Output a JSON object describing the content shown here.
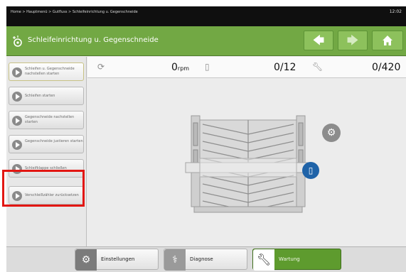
{
  "breadcrumb": {
    "text": "Home > Hauptmenü > Gutfluss > Schleifeinrichtung u. Gegenschneide"
  },
  "clock": {
    "time": "12:02"
  },
  "header": {
    "title": "Schleifeinrichtung u. Gegenschneide",
    "back_icon": "arrow-left-icon",
    "forward_icon": "arrow-right-icon",
    "home_icon": "home-icon"
  },
  "sidebar": {
    "items": [
      {
        "label": "Schleifen u. Gegenschneide nachstellen starten"
      },
      {
        "label": "Schleifen starten"
      },
      {
        "label": "Gegenschneide nachstellen starten"
      },
      {
        "label": "Gegenschneide justieren starten"
      },
      {
        "label": "Schleifklappe schließen"
      },
      {
        "label": "Verschleißzähler zurücksetzen"
      }
    ]
  },
  "status": {
    "rpm_value": "0",
    "rpm_unit": "rpm",
    "count": "0/12",
    "tool_count": "0/420"
  },
  "bottom": {
    "settings_label": "Einstellungen",
    "diagnose_label": "Diagnose",
    "maintenance_label": "Wartung"
  },
  "colors": {
    "header_green": "#72a844",
    "maintenance_green": "#5e9b2e",
    "info_blue": "#1f63a8",
    "highlight_red": "#e21612"
  }
}
